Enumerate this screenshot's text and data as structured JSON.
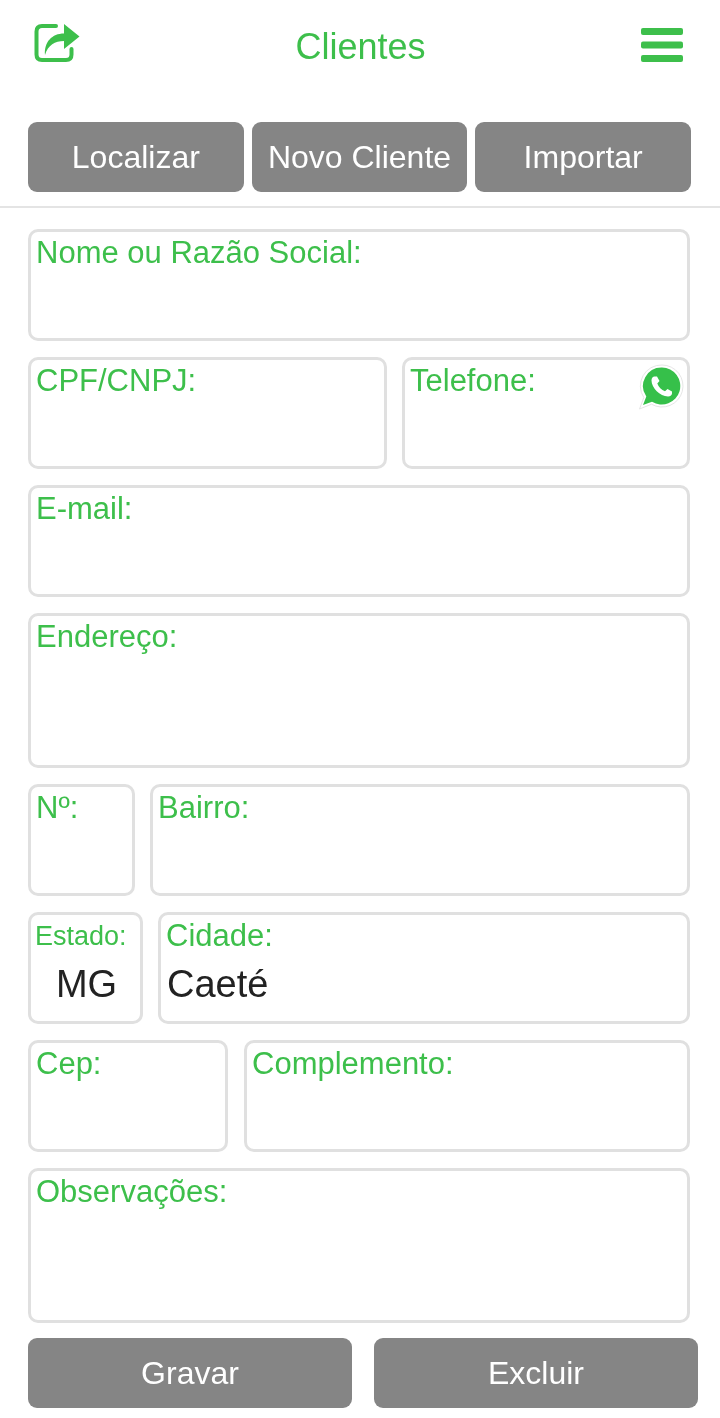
{
  "header": {
    "title": "Clientes"
  },
  "actions": [
    {
      "label": "Localizar"
    },
    {
      "label": "Novo Cliente"
    },
    {
      "label": "Importar"
    }
  ],
  "form": {
    "rows": [
      {
        "fields": [
          {
            "kind": "text",
            "label": "Nome ou Razão Social:"
          }
        ]
      },
      {
        "fields": [
          {
            "kind": "text",
            "label": "CPF/CNPJ:"
          },
          {
            "kind": "phone",
            "label": "Telefone:"
          }
        ]
      },
      {
        "fields": [
          {
            "kind": "text",
            "label": "E-mail:"
          }
        ]
      },
      {
        "fields": [
          {
            "kind": "text",
            "label": "Endereço:"
          }
        ]
      },
      {
        "fields": [
          {
            "kind": "text",
            "label": "Nº:"
          },
          {
            "kind": "text",
            "label": "Bairro:"
          }
        ]
      },
      {
        "fields": [
          {
            "kind": "picker",
            "label": "Estado:",
            "value": "MG"
          },
          {
            "kind": "text",
            "label": "Cidade:",
            "value": "Caeté"
          }
        ]
      },
      {
        "fields": [
          {
            "kind": "text",
            "label": "Cep:"
          },
          {
            "kind": "text",
            "label": "Complemento:"
          }
        ]
      },
      {
        "fields": [
          {
            "kind": "text",
            "label": "Observações:"
          }
        ]
      }
    ]
  },
  "footer_buttons": [
    {
      "label": "Gravar"
    },
    {
      "label": "Excluir"
    }
  ]
}
